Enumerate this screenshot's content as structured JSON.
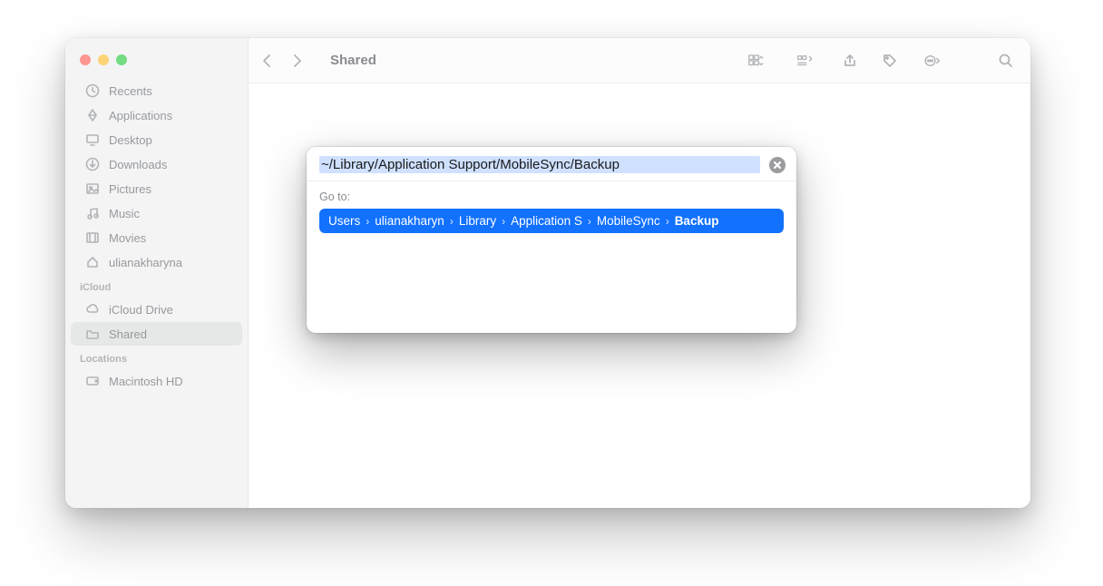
{
  "window": {
    "title": "Shared"
  },
  "sidebar": {
    "favorites": [
      {
        "icon": "clock-icon",
        "label": "Recents"
      },
      {
        "icon": "app-icon",
        "label": "Applications"
      },
      {
        "icon": "desktop-icon",
        "label": "Desktop"
      },
      {
        "icon": "downloads-icon",
        "label": "Downloads"
      },
      {
        "icon": "pictures-icon",
        "label": "Pictures"
      },
      {
        "icon": "music-icon",
        "label": "Music"
      },
      {
        "icon": "movies-icon",
        "label": "Movies"
      },
      {
        "icon": "home-icon",
        "label": "ulianakharyna"
      }
    ],
    "icloud_label": "iCloud",
    "icloud": [
      {
        "icon": "cloud-icon",
        "label": "iCloud Drive"
      },
      {
        "icon": "folder-icon",
        "label": "Shared",
        "selected": true
      }
    ],
    "locations_label": "Locations",
    "locations": [
      {
        "icon": "disk-icon",
        "label": "Macintosh HD"
      }
    ]
  },
  "goto": {
    "input": "~/Library/Application Support/MobileSync/Backup",
    "label": "Go to:",
    "segments": [
      "Users",
      "ulianakharyna",
      "Library",
      "Application S",
      "MobileSync",
      "Backup"
    ],
    "segments_display": [
      "Users",
      "ulianakharyn",
      "Library",
      "Application S",
      "MobileSync",
      "Backup"
    ]
  }
}
